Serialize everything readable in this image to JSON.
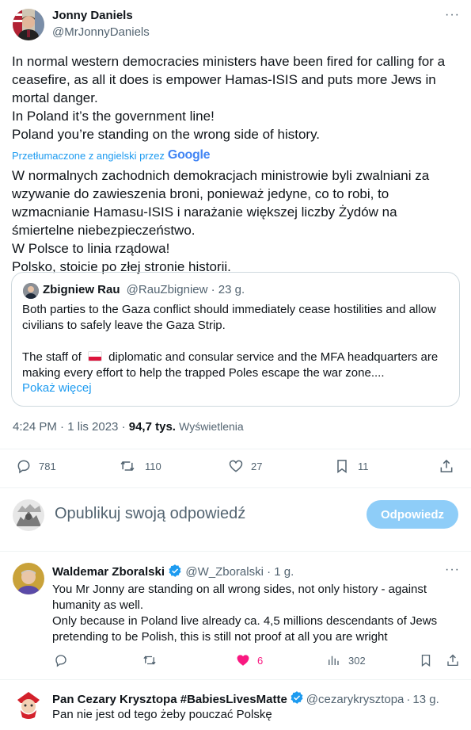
{
  "main_tweet": {
    "author_name": "Jonny Daniels",
    "author_handle": "@MrJonnyDaniels",
    "more": "···",
    "text_lines": [
      "In normal western democracies ministers have been fired for calling for a ceasefire, as all it does is empower Hamas-ISIS and puts more Jews in mortal danger.",
      "In Poland it’s the government line!",
      "Poland you’re standing on the wrong side of history."
    ],
    "translated_by": "Przetłumaczone z angielski przez",
    "google": "Google",
    "translation_lines": [
      "W normalnych zachodnich demokracjach ministrowie byli zwalniani za wzywanie do zawieszenia broni, ponieważ jedyne, co to robi, to wzmacnianie Hamasu-ISIS i narażanie większej liczby Żydów na śmiertelne niebezpieczeństwo.",
      "W Polsce to linia rządowa!",
      "Polsko, stoicie po złej stronie historii."
    ],
    "quote": {
      "author_name": "Zbigniew Rau",
      "author_handle": "@RauZbigniew",
      "sep": "·",
      "time": "23 g.",
      "line1": "Both parties to the Gaza conflict should immediately cease hostilities and allow civilians to safely leave the Gaza Strip.",
      "line2_pre": "The staff of",
      "line2_post": "diplomatic and consular service and the MFA headquarters are making every effort to help the trapped Poles escape the war zone....",
      "show_more": "Pokaż więcej"
    },
    "timestamp": "4:24 PM · 1 lis 2023 ·",
    "views_count": "94,7 tys.",
    "views_label": "Wyświetlenia",
    "stats": {
      "replies": "781",
      "retweets": "110",
      "likes": "27",
      "bookmarks": "11"
    }
  },
  "compose": {
    "placeholder": "Opublikuj swoją odpowiedź",
    "button": "Odpowiedz"
  },
  "replies": [
    {
      "author_name": "Waldemar Zboralski",
      "author_handle": "@W_Zboralski",
      "sep": "·",
      "time": "1 g.",
      "more": "···",
      "text": "You Mr Jonny are standing on all wrong sides, not only history - against humanity as well.\nOnly because in Poland live already ca. 4,5 millions descendants of Jews pretending to be Polish, this is still not proof at all  you are wright",
      "likes": "6",
      "views": "302"
    },
    {
      "author_name": "Pan Cezary Krysztopa #BabiesLivesMatte",
      "author_handle": "@cezarykrysztopa",
      "sep": "·",
      "time": "13 g.",
      "text": "Pan nie jest od tego żeby pouczać Polskę"
    }
  ],
  "colors": {
    "accent": "#1d9bf0",
    "muted": "#536471",
    "like_pink": "#f91880",
    "reply_button": "#8ecdf8"
  }
}
